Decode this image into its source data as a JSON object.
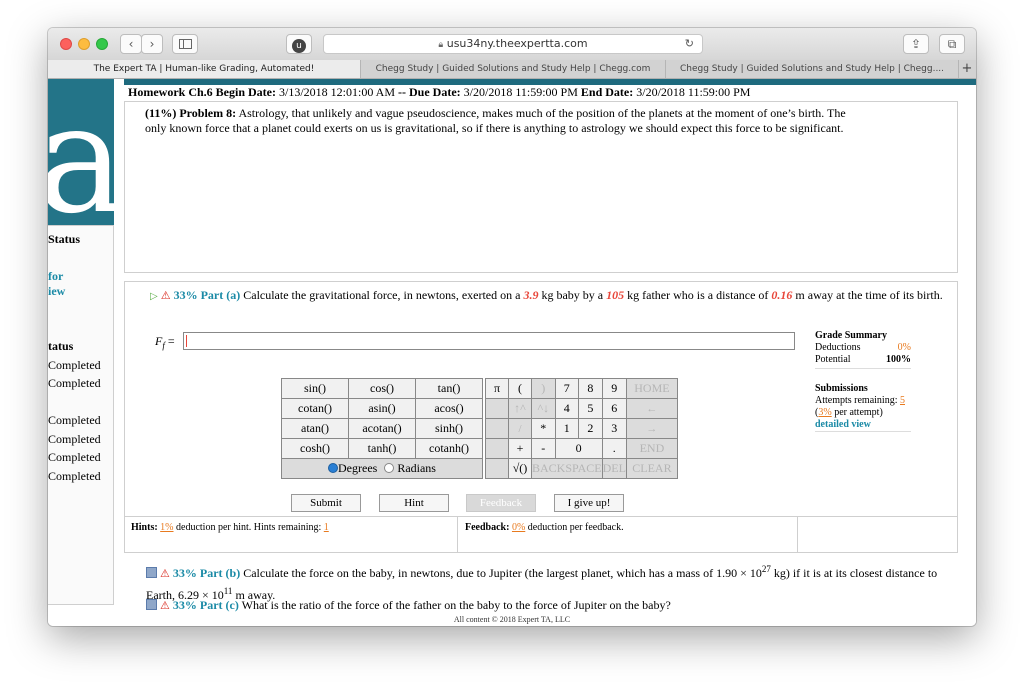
{
  "browser": {
    "url": "usu34ny.theexpertta.com",
    "tabs": [
      "The Expert TA | Human-like Grading, Automated!",
      "Chegg Study | Guided Solutions and Study Help | Chegg.com",
      "Chegg Study | Guided Solutions and Study Help | Chegg...."
    ]
  },
  "logo_letter": "a",
  "sidebar": {
    "status_heading": "Status",
    "link1": "for",
    "link2": "iew",
    "status_heading2": "tatus",
    "statuses": [
      "Completed",
      "Completed",
      "Completed",
      "Completed",
      "Completed",
      "Completed"
    ]
  },
  "header": {
    "label": "Homework Ch.6 Begin Date:",
    "begin": "3/13/2018 12:01:00 AM",
    "due_label": "-- Due Date:",
    "due": "3/20/2018 11:59:00 PM",
    "end_label": "End Date:",
    "end": "3/20/2018 11:59:00 PM"
  },
  "problem": {
    "label": "(11%) Problem 8:",
    "text": "Astrology, that unlikely and vague pseudoscience, makes much of the position of the planets at the moment of one’s birth. The only known force that a planet could exerts on us is gravitational, so if there is anything to astrology we should expect this force to be significant."
  },
  "partA": {
    "label": "33% Part (a)",
    "t1": "Calculate the gravitational force, in newtons, exerted on a",
    "v1": "3.9",
    "t2": "kg baby by a",
    "v2": "105",
    "t3": "kg father who is a distance of",
    "v3": "0.16",
    "t4": "m away at the time of its birth.",
    "input_label": "F",
    "input_sub": "f",
    "input_eq": "=",
    "input_value": ""
  },
  "calculator": {
    "functions": [
      [
        "sin()",
        "cos()",
        "tan()"
      ],
      [
        "cotan()",
        "asin()",
        "acos()"
      ],
      [
        "atan()",
        "acotan()",
        "sinh()"
      ],
      [
        "cosh()",
        "tanh()",
        "cotanh()"
      ]
    ],
    "pi": "π",
    "open": "(",
    "close": ")",
    "digits": [
      [
        "7",
        "8",
        "9"
      ],
      [
        "4",
        "5",
        "6"
      ],
      [
        "1",
        "2",
        "3"
      ]
    ],
    "zero": "0",
    "dot": ".",
    "plus": "+",
    "minus": "-",
    "times": "*",
    "divide": "/",
    "up": "↑^",
    "down": "^↓",
    "sqrt": "√()",
    "home": "HOME",
    "back_arrow": "←",
    "fwd_arrow": "→",
    "end": "END",
    "backspace": "BACKSPACE",
    "del": "DEL",
    "clear": "CLEAR",
    "degrees": "Degrees",
    "radians": "Radians"
  },
  "buttons": {
    "submit": "Submit",
    "hint": "Hint",
    "feedback": "Feedback",
    "give_up": "I give up!"
  },
  "hints": {
    "label": "Hints:",
    "pct": "1%",
    "text": "deduction per hint. Hints remaining:",
    "remaining": "1"
  },
  "feedback": {
    "label": "Feedback:",
    "pct": "0%",
    "text": "deduction per feedback."
  },
  "grade_summary": {
    "title": "Grade Summary",
    "deductions_label": "Deductions",
    "deductions": "0%",
    "potential_label": "Potential",
    "potential": "100%",
    "submissions_title": "Submissions",
    "attempts_label": "Attempts remaining:",
    "attempts": "5",
    "per_attempt_pct": "3%",
    "per_attempt": "per attempt)",
    "detailed": "detailed view"
  },
  "partB": {
    "label": "33% Part (b)",
    "text": "Calculate the force on the baby, in newtons, due to Jupiter (the largest planet, which has a mass of 1.90 × 10",
    "exp": "27",
    "text2": "kg) if it is at its closest distance to Earth, 6.29 × 10",
    "exp2": "11",
    "text3": "m away."
  },
  "partC": {
    "label": "33% Part (c)",
    "text": "What is the ratio of the force of the father on the baby to the force of Jupiter on the baby?"
  },
  "footer": "All content © 2018 Expert TA, LLC"
}
